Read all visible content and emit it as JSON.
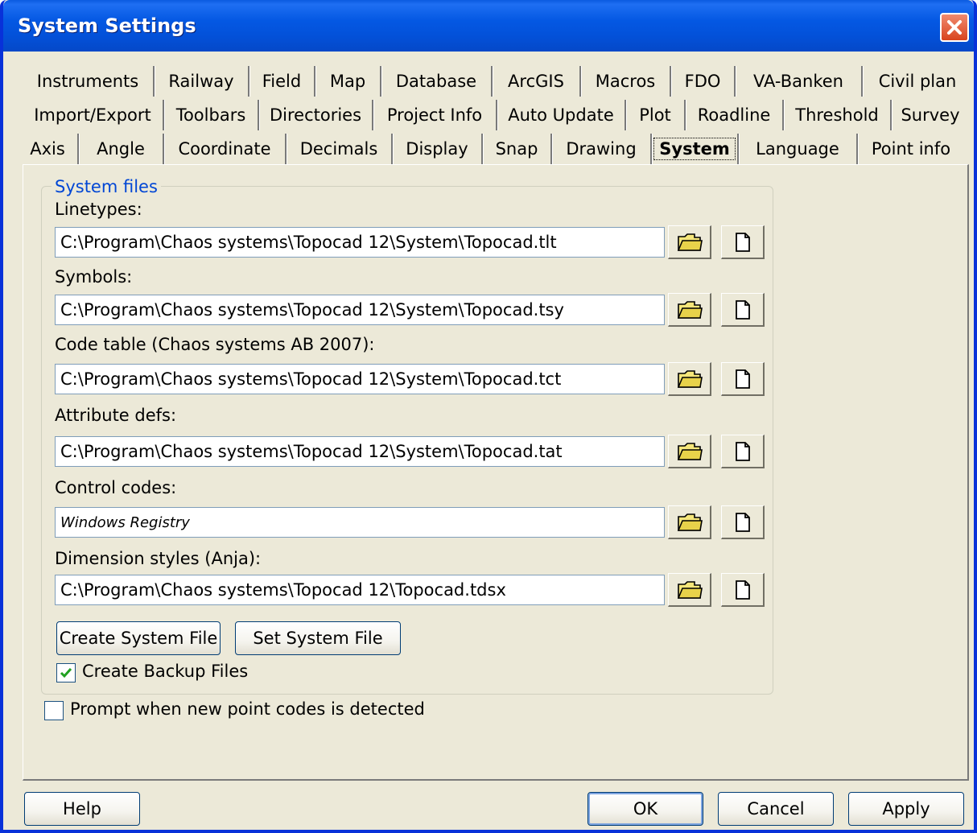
{
  "window": {
    "title": "System Settings"
  },
  "tabs": {
    "row1": [
      "Instruments",
      "Railway",
      "Field",
      "Map",
      "Database",
      "ArcGIS",
      "Macros",
      "FDO",
      "VA-Banken",
      "Civil plan"
    ],
    "row2": [
      "Import/Export",
      "Toolbars",
      "Directories",
      "Project Info",
      "Auto Update",
      "Plot",
      "Roadline",
      "Threshold",
      "Survey"
    ],
    "row3": [
      "Axis",
      "Angle",
      "Coordinate",
      "Decimals",
      "Display",
      "Snap",
      "Drawing",
      "System",
      "Language",
      "Point info"
    ],
    "active": "System"
  },
  "group": {
    "title": "System files",
    "fields": [
      {
        "label": "Linetypes:",
        "value": "C:\\Program\\Chaos systems\\Topocad 12\\System\\Topocad.tlt"
      },
      {
        "label": "Symbols:",
        "value": "C:\\Program\\Chaos systems\\Topocad 12\\System\\Topocad.tsy"
      },
      {
        "label": "Code table (Chaos systems AB 2007):",
        "value": "C:\\Program\\Chaos systems\\Topocad 12\\System\\Topocad.tct"
      },
      {
        "label": "Attribute defs:",
        "value": "C:\\Program\\Chaos systems\\Topocad 12\\System\\Topocad.tat"
      },
      {
        "label": "Control codes:",
        "value": "Windows Registry"
      },
      {
        "label": "Dimension styles (Anja):",
        "value": "C:\\Program\\Chaos systems\\Topocad 12\\Topocad.tdsx"
      }
    ],
    "create_button": "Create System File",
    "set_button": "Set System File",
    "backup_checkbox": {
      "label": "Create Backup Files",
      "checked": true
    }
  },
  "prompt_checkbox": {
    "label": "Prompt when new point codes is detected",
    "checked": false
  },
  "footer": {
    "help": "Help",
    "ok": "OK",
    "cancel": "Cancel",
    "apply": "Apply"
  },
  "icons": {
    "browse": "folder-icon",
    "new": "new-file-icon",
    "close": "close-icon"
  }
}
